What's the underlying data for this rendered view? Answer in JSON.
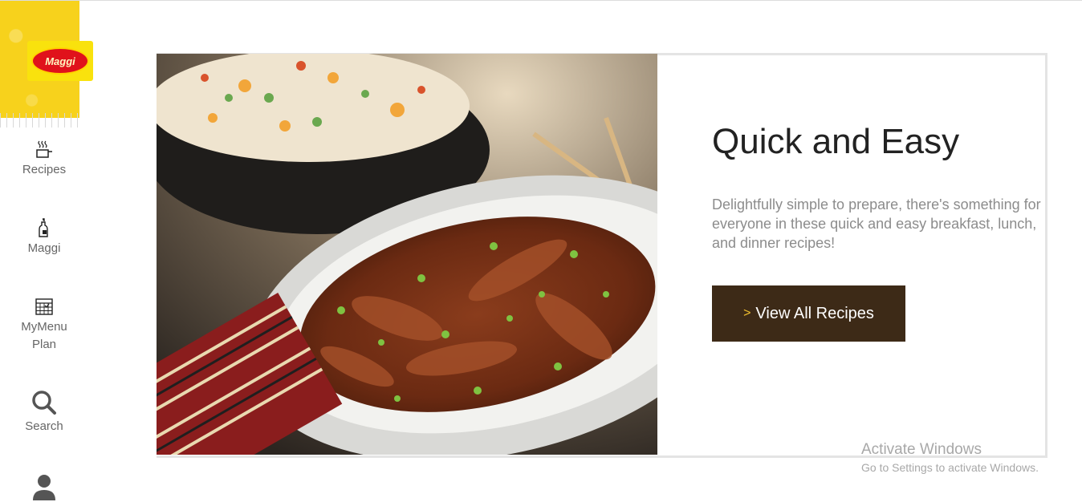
{
  "brand": {
    "logo_text": "Maggi"
  },
  "sidebar": {
    "items": [
      {
        "label": "Recipes",
        "icon": "cooking-pot-icon"
      },
      {
        "label": "Maggi",
        "icon": "maggi-bottle-icon"
      },
      {
        "label": "MyMenu Plan",
        "icon": "calendar-icon"
      },
      {
        "label": "Search",
        "icon": "search-icon"
      },
      {
        "label": "",
        "icon": "user-icon"
      }
    ]
  },
  "hero": {
    "title": "Quick and Easy",
    "description": "Delightfully simple to prepare, there's something for everyone in these quick and easy breakfast, lunch, and dinner recipes!",
    "button_label": "View All Recipes",
    "button_chevron": ">",
    "image_alt": "Fried rice and glazed beef dish"
  },
  "watermark": {
    "title": "Activate Windows",
    "subtitle": "Go to Settings to activate Windows."
  },
  "colors": {
    "brand_yellow": "#f7d21c",
    "brand_red": "#e0121b",
    "button_bg": "#3d2a17",
    "button_chevron": "#f2c12e"
  }
}
